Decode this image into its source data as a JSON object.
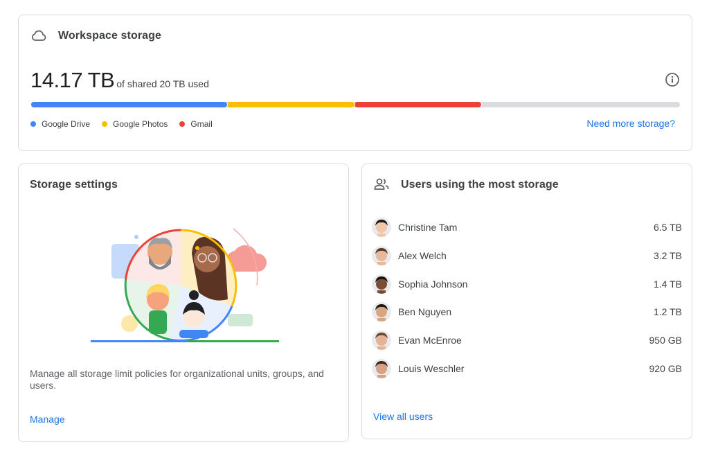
{
  "workspace": {
    "title": "Workspace storage",
    "icon": "cloud-icon",
    "used_value": "14.17 TB",
    "used_suffix": "of shared 20 TB used",
    "info_icon": "info-icon",
    "usage_breakdown_percent": {
      "google_drive": 30.2,
      "google_photos": 19.6,
      "gmail": 19.6
    },
    "legend": [
      {
        "label": "Google Drive",
        "color": "#4285f4"
      },
      {
        "label": "Google Photos",
        "color": "#fbbc04"
      },
      {
        "label": "Gmail",
        "color": "#ea4335"
      }
    ],
    "unused_color": "#dadce0",
    "more_link": "Need more storage?"
  },
  "settings": {
    "title": "Storage settings",
    "description": "Manage all storage limit policies for organizational units, groups, and users.",
    "link": "Manage"
  },
  "users": {
    "title": "Users using the most storage",
    "icon": "people-icon",
    "list": [
      {
        "name": "Christine Tam",
        "size": "6.5 TB",
        "skin": "#f1c7a8",
        "hair": "#1f1a17"
      },
      {
        "name": "Alex Welch",
        "size": "3.2 TB",
        "skin": "#e8b89a",
        "hair": "#5b3a29"
      },
      {
        "name": "Sophia Johnson",
        "size": "1.4 TB",
        "skin": "#7a4e33",
        "hair": "#1a1411"
      },
      {
        "name": "Ben Nguyen",
        "size": "1.2 TB",
        "skin": "#d9a67f",
        "hair": "#1b1714"
      },
      {
        "name": "Evan McEnroe",
        "size": "950 GB",
        "skin": "#e4b396",
        "hair": "#6b4a34"
      },
      {
        "name": "Louis Weschler",
        "size": "920 GB",
        "skin": "#d7a283",
        "hair": "#3e2a1e"
      }
    ],
    "link": "View all users"
  }
}
